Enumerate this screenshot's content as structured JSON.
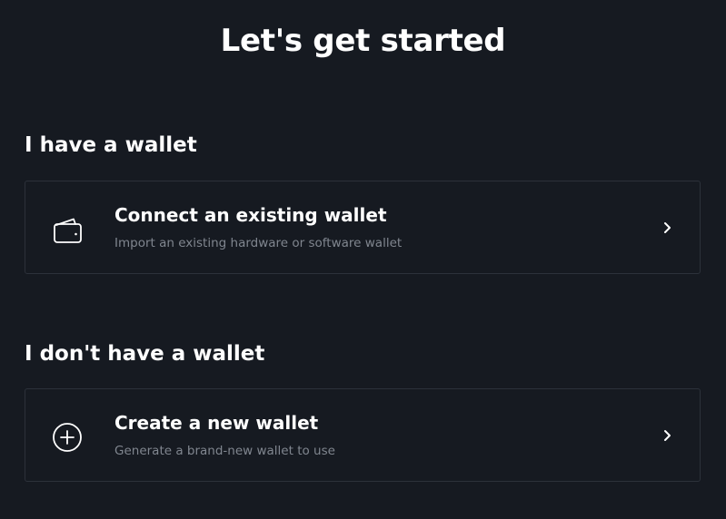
{
  "page": {
    "title": "Let's get started"
  },
  "sections": [
    {
      "heading": "I have a wallet",
      "option": {
        "title": "Connect an existing wallet",
        "description": "Import an existing hardware or software wallet",
        "icon": "wallet-icon"
      }
    },
    {
      "heading": "I don't have a wallet",
      "option": {
        "title": "Create a new wallet",
        "description": "Generate a brand-new wallet to use",
        "icon": "plus-circle-icon"
      }
    }
  ],
  "colors": {
    "background": "#161a21",
    "card_border": "#2c313a",
    "text_primary": "#ffffff",
    "text_secondary": "#80868f"
  }
}
